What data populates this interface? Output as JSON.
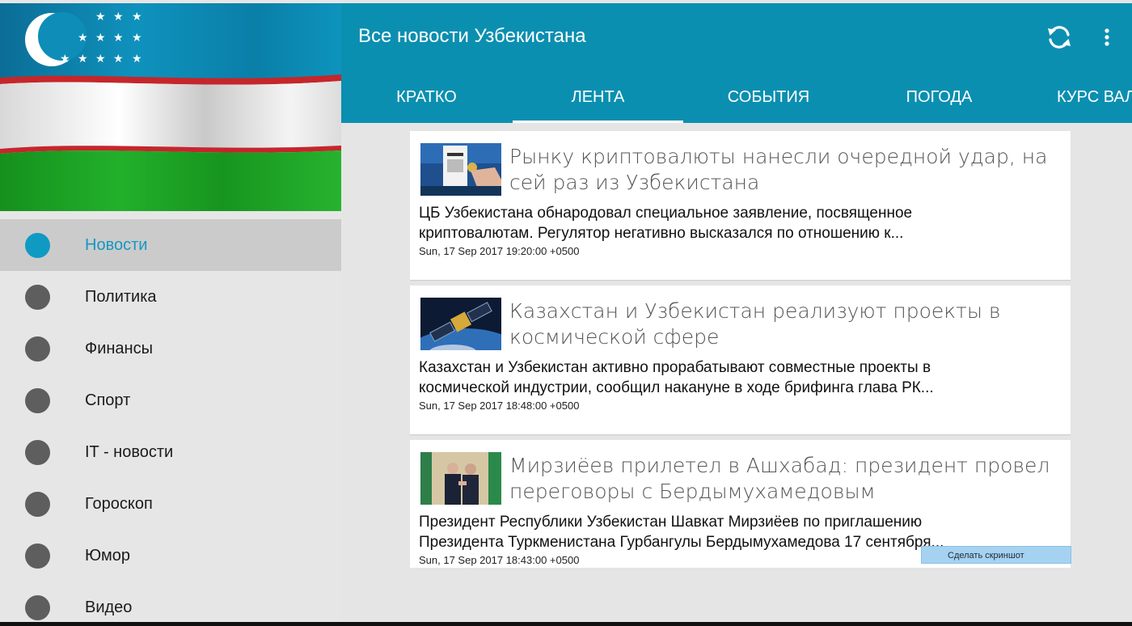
{
  "drawer": {
    "nav_items": [
      {
        "label": "Новости",
        "active": true
      },
      {
        "label": "Политика"
      },
      {
        "label": "Финансы"
      },
      {
        "label": "Спорт"
      },
      {
        "label": "IT - новости"
      },
      {
        "label": "Гороскоп"
      },
      {
        "label": "Юмор"
      },
      {
        "label": "Видео"
      }
    ]
  },
  "toolbar": {
    "title": "Все новости Узбекистана",
    "refresh_icon": "refresh-icon",
    "more_icon": "more-vert-icon"
  },
  "tabs": [
    {
      "label": "КРАТКО"
    },
    {
      "label": "ЛЕНТА",
      "active": true
    },
    {
      "label": "СОБЫТИЯ"
    },
    {
      "label": "ПОГОДА"
    },
    {
      "label": "КУРС ВАЛ"
    }
  ],
  "feed": {
    "articles": [
      {
        "title": "Рынку криптовалюты нанесли очередной удар, на сей раз из Узбекистана",
        "summary": "ЦБ Узбекистана обнародовал специальное заявление, посвященное\nкриптовалютам. Регулятор негативно высказался по отношению к...",
        "date": "Sun, 17 Sep 2017 19:20:00 +0500"
      },
      {
        "title": "Казахстан и Узбекистан реализуют проекты в космической сфере",
        "summary": "Казахстан и Узбекистан активно прорабатывают совместные проекты в\nкосмической индустрии, сообщил накануне в ходе брифинга глава РК...",
        "date": "Sun, 17 Sep 2017 18:48:00 +0500"
      },
      {
        "title": "Мирзиёев прилетел в Ашхабад: президент провел переговоры с Бердымухамедовым",
        "summary": "Президент Республики Узбекистан Шавкат Мирзиёев по приглашению\nПрезидента Туркменистана Гурбангулы Бердымухамедова 17 сентября...",
        "date": "Sun, 17 Sep 2017 18:43:00 +0500"
      }
    ]
  },
  "overlay": {
    "screenshot_label": "Сделать скриншот"
  },
  "colors": {
    "accent": "#0b8fb0",
    "active_nav": "#1597c2",
    "nav_dot": "#5e5e5e"
  }
}
